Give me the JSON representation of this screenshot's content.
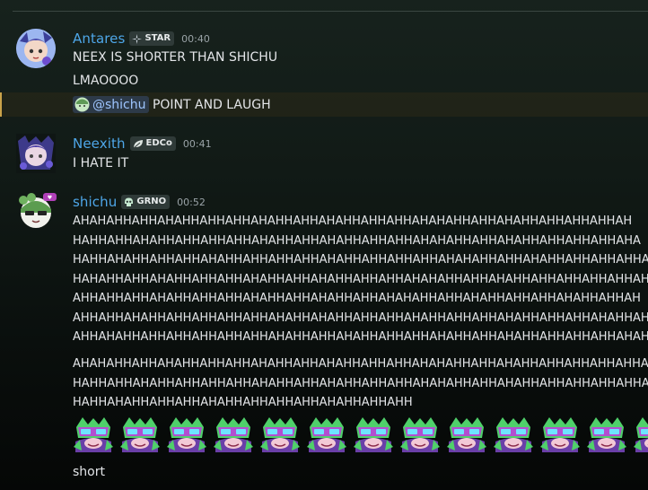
{
  "messages": [
    {
      "username": "Antares",
      "tag": "STAR",
      "time": "00:40",
      "lines": [
        "NEEX IS SHORTER THAN SHICHU",
        "LMAOOOO"
      ],
      "mention": {
        "name": "@shichu",
        "text": " POINT AND LAUGH"
      }
    },
    {
      "username": "Neexith",
      "tag": "EDCo",
      "time": "00:41",
      "lines": [
        "I HATE IT"
      ]
    },
    {
      "username": "shichu",
      "tag": "GRNO",
      "time": "00:52",
      "block1": [
        "AHAHAHHAHHAHAHHAHHAHHAHAHHAHHAHAHHAHHAHHAHAHAHHAHHAHAHHAHHAHHAHHAH",
        "HAHHAHHAHAHHAHHAHHAHHAHAHHAHHAHAHHAHHAHHAHAHAHHAHHAHAHHAHHAHHAHHAHA",
        "HAHHAHAHHAHHAHHAHAHHAHHAHHAHHAHAHHAHHAHHAHHAHAHAHHAHHAHAHHAHHAHHAHHAHA",
        "HAHAHHAHHAHAHHAHHAHHAHAHHAHHAHAHHAHHAHHAHAHAHHAHHAHAHHAHHAHHAHHAHHAHA",
        "AHHAHHAHHAHAHHAHHAHHAHAHHAHHAHAHHAHHAHAHAHHAHHAHAHHAHHAHHAHAHHAHHAH",
        "AHHAHHAHAHHAHHAHHAHHAHHAHAHHAHAHHAHHAHHAHAHHAHHAHHAHAHHAHHAHHAHAHHAH",
        "AHHAHAHHAHHAHHAHHAHHAHHAHAHHAHHAHAHHAHHAHHAHAHHAHHAHAHHAHHAHHAHHAHAH"
      ],
      "block2": [
        "AHAHAHHAHHAHAHHAHHAHHAHAHHAHHAHAHHAHHAHHAHAHAHHAHHAHAHHAHHAHHAHHAHHAH",
        "HAHHAHHAHAHHAHHAHHAHHAHAHHAHHAHAHHAHHAHHAHAHAHHAHHAHAHHAHHAHHAHHAHHAHA",
        "HAHHAHAHHAHHAHHAHAHHAHHAHHAHHAHAHHAHHAHH"
      ],
      "emoji_count": 13,
      "last_line": "short"
    }
  ],
  "colors": {
    "username": "#4ea6e8",
    "mention_bar": "#c9a24a",
    "tag_bg": "#2f3a38"
  }
}
